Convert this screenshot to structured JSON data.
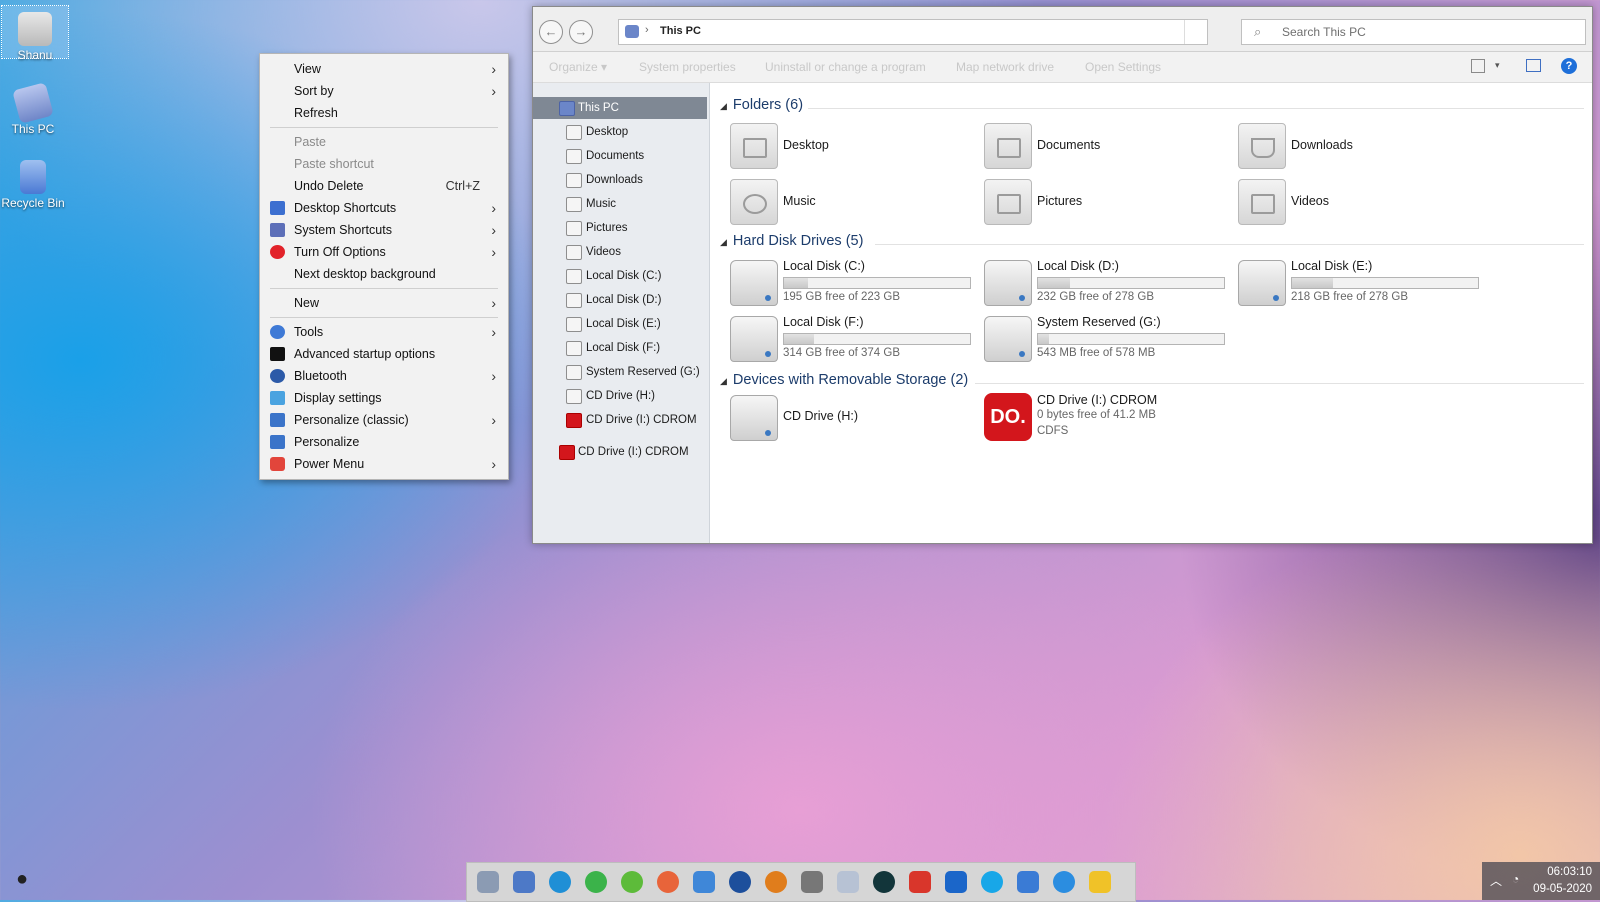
{
  "desktop": {
    "icons": [
      {
        "label": "Shanu",
        "icon": "user-folder-icon"
      },
      {
        "label": "This PC",
        "icon": "computer-icon"
      },
      {
        "label": "Recycle Bin",
        "icon": "recycle-bin-icon"
      }
    ]
  },
  "context_menu": {
    "items": [
      {
        "label": "View",
        "submenu": true
      },
      {
        "label": "Sort by",
        "submenu": true
      },
      {
        "label": "Refresh"
      },
      {
        "label": "Paste",
        "disabled": true
      },
      {
        "label": "Paste shortcut",
        "disabled": true
      },
      {
        "label": "Undo Delete",
        "shortcut": "Ctrl+Z"
      },
      {
        "label": "Desktop Shortcuts",
        "icon": "monitor-icon",
        "submenu": true
      },
      {
        "label": "System Shortcuts",
        "icon": "system-icon",
        "submenu": true
      },
      {
        "label": "Turn Off Options",
        "icon": "power-icon",
        "submenu": true
      },
      {
        "label": "Next desktop background"
      },
      {
        "label": "New",
        "submenu": true
      },
      {
        "label": "Tools",
        "icon": "tools-icon",
        "submenu": true
      },
      {
        "label": "Advanced startup options",
        "icon": "cmd-icon"
      },
      {
        "label": "Bluetooth",
        "icon": "bluetooth-icon",
        "submenu": true
      },
      {
        "label": "Display settings",
        "icon": "display-icon"
      },
      {
        "label": "Personalize (classic)",
        "icon": "personalize-icon",
        "submenu": true
      },
      {
        "label": "Personalize",
        "icon": "personalize-icon"
      },
      {
        "label": "Power Menu",
        "icon": "power-icon",
        "submenu": true
      }
    ]
  },
  "explorer": {
    "address": {
      "crumb": "This PC"
    },
    "search_placeholder": "Search This PC",
    "toolbar": {
      "organize": "Organize ▾",
      "system_properties": "System properties",
      "uninstall": "Uninstall or change a program",
      "map_drive": "Map network drive",
      "open_settings": "Open Settings"
    },
    "nav": [
      {
        "label": "This PC",
        "selected": true
      },
      {
        "label": "Desktop"
      },
      {
        "label": "Documents"
      },
      {
        "label": "Downloads"
      },
      {
        "label": "Music"
      },
      {
        "label": "Pictures"
      },
      {
        "label": "Videos"
      },
      {
        "label": "Local Disk (C:)"
      },
      {
        "label": "Local Disk (D:)"
      },
      {
        "label": "Local Disk (E:)"
      },
      {
        "label": "Local Disk (F:)"
      },
      {
        "label": "System Reserved (G:)"
      },
      {
        "label": "CD Drive (H:)"
      },
      {
        "label": "CD Drive (I:) CDROM"
      },
      {
        "label": "CD Drive (I:) CDROM"
      }
    ],
    "groups": {
      "folders": "Folders (6)",
      "drives": "Hard Disk Drives (5)",
      "removable": "Devices with Removable Storage (2)"
    },
    "folders": [
      "Desktop",
      "Documents",
      "Downloads",
      "Music",
      "Pictures",
      "Videos"
    ],
    "drives": [
      {
        "name": "Local Disk (C:)",
        "free": "195 GB free of 223 GB",
        "used_fraction": 0.13
      },
      {
        "name": "Local Disk (D:)",
        "free": "232 GB free of 278 GB",
        "used_fraction": 0.17
      },
      {
        "name": "Local Disk (E:)",
        "free": "218 GB free of 278 GB",
        "used_fraction": 0.22
      },
      {
        "name": "Local Disk (F:)",
        "free": "314 GB free of 374 GB",
        "used_fraction": 0.16
      },
      {
        "name": "System Reserved (G:)",
        "free": "543 MB free of 578 MB",
        "used_fraction": 0.06
      }
    ],
    "removable": [
      {
        "name": "CD Drive (H:)"
      },
      {
        "name": "CD Drive (I:) CDROM",
        "free": "0 bytes free of 41.2 MB",
        "fs": "CDFS",
        "badge": "DO."
      }
    ]
  },
  "tray": {
    "time": "06:03:10",
    "date": "09-05-2020"
  }
}
